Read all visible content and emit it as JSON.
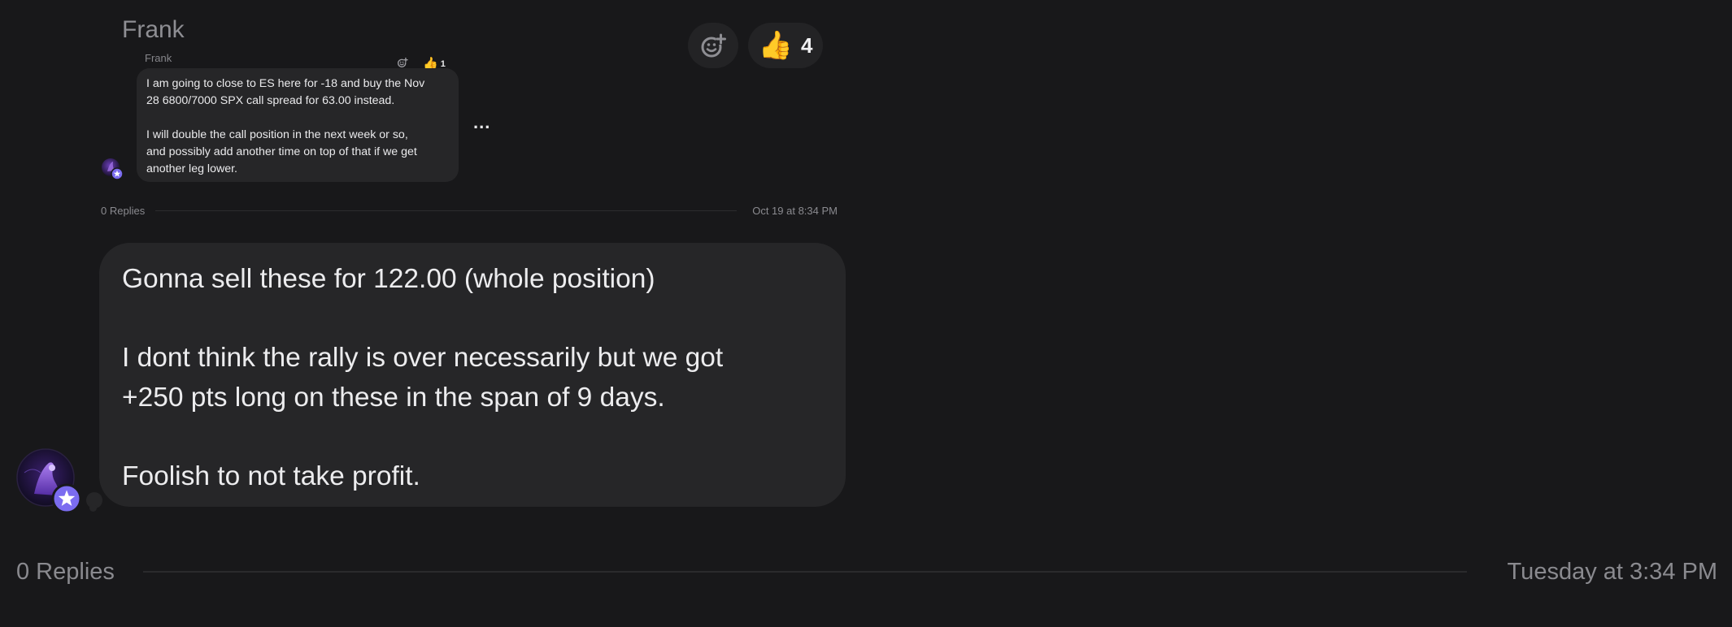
{
  "header": {
    "author": "Frank"
  },
  "reactions": {
    "add_icon": "add-reaction-icon",
    "thumbs_emoji": "👍",
    "thumbs_count": "4"
  },
  "quoted": {
    "author": "Frank",
    "text": "I am going to close to ES here for -18 and buy the Nov\n28 6800/7000 SPX call spread for 63.00 instead.\n\nI will double the call position in the next week or so,\nand possibly add another time on top of that if we get\nanother leg lower.",
    "thumbs_emoji": "👍",
    "thumbs_count": "1",
    "more": "...",
    "replies": "0 Replies",
    "timestamp": "Oct 19 at 8:34 PM"
  },
  "message": {
    "text": "Gonna sell these for 122.00 (whole position)\n\nI dont think the rally is over necessarily but we got\n+250 pts long on these in the span of 9 days.\n\nFoolish to not take profit.",
    "replies": "0 Replies",
    "timestamp": "Tuesday at 3:34 PM"
  },
  "colors": {
    "background": "#18181a",
    "bubble": "#262628",
    "badge": "#7b6cf0",
    "muted_text": "#8a8a8f"
  }
}
